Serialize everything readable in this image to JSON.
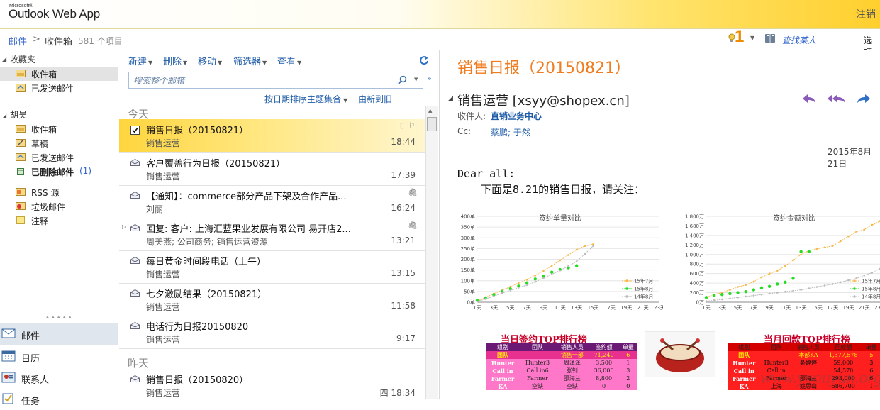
{
  "header": {
    "ms_label": "Microsoft®",
    "app_title": "Outlook Web App",
    "signout": "注销",
    "notification_count": "1",
    "find_people": "查找某人",
    "options": "选项"
  },
  "breadcrumb": {
    "mail": "邮件",
    "separator": ">",
    "folder": "收件箱",
    "count": "581 个项目"
  },
  "nav": {
    "favorites_label": "收藏夹",
    "favorites": [
      {
        "label": "收件箱",
        "icon": "inbox-icon"
      },
      {
        "label": "已发送邮件",
        "icon": "sent-icon"
      }
    ],
    "account_label": "胡昊",
    "folders": [
      {
        "label": "收件箱",
        "icon": "inbox-icon"
      },
      {
        "label": "草稿",
        "icon": "drafts-icon"
      },
      {
        "label": "已发送邮件",
        "icon": "sent-icon"
      },
      {
        "label": "已删除邮件",
        "icon": "deleted-icon",
        "count": "(1)"
      },
      {
        "label": "RSS 源",
        "icon": "rss-icon"
      },
      {
        "label": "垃圾邮件",
        "icon": "junk-icon"
      },
      {
        "label": "注释",
        "icon": "notes-icon"
      }
    ],
    "modules": [
      {
        "label": "邮件",
        "icon": "mail-icon"
      },
      {
        "label": "日历",
        "icon": "calendar-icon"
      },
      {
        "label": "联系人",
        "icon": "contacts-icon"
      },
      {
        "label": "任务",
        "icon": "tasks-icon"
      }
    ]
  },
  "toolbar": {
    "new": "新建",
    "delete": "删除",
    "move": "移动",
    "filter": "筛选器",
    "view": "查看"
  },
  "search": {
    "placeholder": "搜索整个邮箱"
  },
  "sort": {
    "by": "按日期排序主题集合",
    "order": "由新到旧"
  },
  "groups": {
    "today": "今天",
    "yesterday": "昨天"
  },
  "messages": [
    {
      "subject": "销售日报（20150821）",
      "from": "销售运营",
      "time": "18:44"
    },
    {
      "subject": "客户覆盖行为日报（20150821）",
      "from": "销售运营",
      "time": "17:39"
    },
    {
      "subject": "【通知】：commerce部分产品下架及合作产品...",
      "from": "刘丽",
      "time": "16:24"
    },
    {
      "subject": "回复: 客户: 上海汇蓝果业发展有限公司 易开店2...",
      "from": "周美燕; 公司商务; 销售运营资源",
      "time": "13:21"
    },
    {
      "subject": "每日黄金时间段电话（上午）",
      "from": "销售运营",
      "time": "13:15"
    },
    {
      "subject": "七夕激励结果（20150821）",
      "from": "销售运营",
      "time": "11:58"
    },
    {
      "subject": "电话行为日报20150820",
      "from": "销售运营",
      "time": "9:17"
    },
    {
      "subject": "销售日报（20150820）",
      "from": "销售运营",
      "time": "四 18:34"
    }
  ],
  "reading": {
    "subject": "销售日报（20150821）",
    "sender": "销售运营 [xsyy@shopex.cn]",
    "to_label": "收件人:",
    "to": "直销业务中心",
    "cc_label": "Cc:",
    "cc": "蔡鹏; 于然",
    "date": "2015年8月21日",
    "greeting": "Dear all:",
    "intro": "下面是8.21的销售日报，请关注："
  },
  "chart_data": [
    {
      "type": "line",
      "title": "签约单量对比",
      "x": [
        "1天",
        "3天",
        "5天",
        "7天",
        "9天",
        "11天",
        "13天",
        "15天",
        "17天",
        "19天",
        "21天",
        "23天"
      ],
      "ylim": [
        0,
        400
      ],
      "yticks": [
        "0单",
        "50单",
        "100单",
        "150单",
        "200单",
        "250单",
        "300单",
        "350单",
        "400单"
      ],
      "series": [
        {
          "name": "15年7月",
          "color": "#f7b84a",
          "values": [
            5,
            22,
            40,
            55,
            72,
            90,
            105,
            125,
            145,
            170,
            195,
            220,
            245,
            262,
            270
          ]
        },
        {
          "name": "15年8月",
          "color": "#22dd22",
          "values": [
            8,
            20,
            35,
            50,
            62,
            75,
            90,
            108,
            120,
            140,
            152,
            160,
            170
          ]
        },
        {
          "name": "14年8月",
          "color": "#bbbbbb",
          "values": [
            3,
            15,
            28,
            42,
            55,
            68,
            80,
            95,
            112,
            130,
            148,
            168,
            190,
            225,
            262
          ]
        }
      ]
    },
    {
      "type": "line",
      "title": "签约金额对比",
      "x": [
        "1天",
        "3天",
        "5天",
        "7天",
        "9天",
        "11天",
        "13天",
        "15天",
        "17天",
        "19天",
        "21天",
        "23天"
      ],
      "ylim": [
        0,
        1800
      ],
      "yticks": [
        "0万",
        "200万",
        "400万",
        "600万",
        "800万",
        "1,000万",
        "1,200万",
        "1,400万",
        "1,600万",
        "1,800万"
      ],
      "series": [
        {
          "name": "15年7月",
          "color": "#f7b84a",
          "values": [
            100,
            160,
            200,
            260,
            320,
            360,
            430,
            520,
            600,
            660,
            760,
            880,
            1000,
            1080,
            1120,
            1150,
            1180,
            1280,
            1380,
            1480,
            1520,
            1620,
            1700
          ]
        },
        {
          "name": "15年8月",
          "color": "#22dd22",
          "values": [
            100,
            140,
            160,
            180,
            200,
            220,
            260,
            300,
            330,
            380,
            420,
            500,
            1060,
            1060
          ]
        },
        {
          "name": "14年8月",
          "color": "#bbbbbb",
          "values": [
            20,
            40,
            60,
            80,
            100,
            120,
            140,
            160,
            180,
            200,
            220,
            240,
            260,
            290,
            320,
            350,
            380,
            420,
            460,
            500,
            560,
            620,
            700
          ]
        }
      ]
    },
    {
      "type": "table",
      "title": "当日签约TOP排行榜",
      "columns": [
        "组别",
        "团队",
        "销售人员",
        "签约额",
        "单量"
      ],
      "rows": [
        [
          "团队",
          "",
          "销售一部",
          "71,240",
          "6"
        ],
        [
          "Hunter",
          "Hunter3",
          "周泽泽",
          "3,500",
          "1"
        ],
        [
          "Call in",
          "Call in6",
          "张钊",
          "36,000",
          "3"
        ],
        [
          "Farmer",
          "Farmer",
          "邵海兰",
          "8,800",
          "2"
        ],
        [
          "KA",
          "空缺",
          "空缺",
          "0",
          "0"
        ]
      ]
    },
    {
      "type": "table",
      "title": "当月回款TOP排行榜",
      "columns": [
        "组别",
        "团队",
        "销售人员",
        "回款额",
        "单量"
      ],
      "rows": [
        [
          "团队",
          "",
          "本部KA",
          "1,377,578",
          "5"
        ],
        [
          "Hunter",
          "Hunter3",
          "綦婷婷",
          "59,000",
          "3"
        ],
        [
          "Call in",
          "Call in",
          "",
          "54,570",
          "6"
        ],
        [
          "Farmer",
          "Farmer",
          "邵海兰",
          "293,000",
          "6"
        ],
        [
          "KA",
          "上海",
          "姚思山",
          "586,700",
          "1"
        ]
      ]
    }
  ],
  "watermark": "www.yoouyun.org"
}
